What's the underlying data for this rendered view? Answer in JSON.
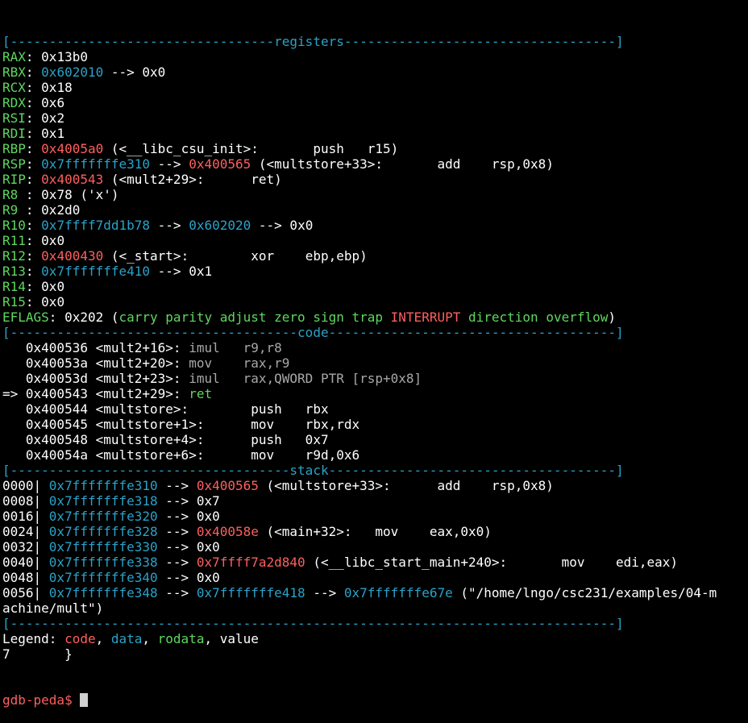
{
  "colors": {
    "background": "#000000",
    "text": "#ffffff",
    "register_name": "#5fd75f",
    "data_address": "#2aa2c8",
    "code_address": "#ff5f5f",
    "dim": "#a8a8a8",
    "cursor": "#d0d0d0"
  },
  "lines": [
    [
      {
        "c": "blue",
        "t": "[----------------------------------registers-----------------------------------]"
      }
    ],
    [
      {
        "c": "green",
        "t": "RAX"
      },
      {
        "c": "white",
        "t": ": 0x13b0"
      }
    ],
    [
      {
        "c": "green",
        "t": "RBX"
      },
      {
        "c": "white",
        "t": ": "
      },
      {
        "c": "blue",
        "t": "0x602010"
      },
      {
        "c": "white",
        "t": " --> 0x0"
      }
    ],
    [
      {
        "c": "green",
        "t": "RCX"
      },
      {
        "c": "white",
        "t": ": 0x18"
      }
    ],
    [
      {
        "c": "green",
        "t": "RDX"
      },
      {
        "c": "white",
        "t": ": 0x6"
      }
    ],
    [
      {
        "c": "green",
        "t": "RSI"
      },
      {
        "c": "white",
        "t": ": 0x2"
      }
    ],
    [
      {
        "c": "green",
        "t": "RDI"
      },
      {
        "c": "white",
        "t": ": 0x1"
      }
    ],
    [
      {
        "c": "green",
        "t": "RBP"
      },
      {
        "c": "white",
        "t": ": "
      },
      {
        "c": "red",
        "t": "0x4005a0"
      },
      {
        "c": "white",
        "t": " (<__libc_csu_init>:       push   r15)"
      }
    ],
    [
      {
        "c": "green",
        "t": "RSP"
      },
      {
        "c": "white",
        "t": ": "
      },
      {
        "c": "blue",
        "t": "0x7fffffffe310"
      },
      {
        "c": "white",
        "t": " --> "
      },
      {
        "c": "red",
        "t": "0x400565"
      },
      {
        "c": "white",
        "t": " (<multstore+33>:       add    rsp,0x8)"
      }
    ],
    [
      {
        "c": "green",
        "t": "RIP"
      },
      {
        "c": "white",
        "t": ": "
      },
      {
        "c": "red",
        "t": "0x400543"
      },
      {
        "c": "white",
        "t": " (<mult2+29>:      ret)"
      }
    ],
    [
      {
        "c": "green",
        "t": "R8 "
      },
      {
        "c": "white",
        "t": ": 0x78 ('x')"
      }
    ],
    [
      {
        "c": "green",
        "t": "R9 "
      },
      {
        "c": "white",
        "t": ": 0x2d0"
      }
    ],
    [
      {
        "c": "green",
        "t": "R10"
      },
      {
        "c": "white",
        "t": ": "
      },
      {
        "c": "blue",
        "t": "0x7ffff7dd1b78"
      },
      {
        "c": "white",
        "t": " --> "
      },
      {
        "c": "blue",
        "t": "0x602020"
      },
      {
        "c": "white",
        "t": " --> 0x0"
      }
    ],
    [
      {
        "c": "green",
        "t": "R11"
      },
      {
        "c": "white",
        "t": ": 0x0"
      }
    ],
    [
      {
        "c": "green",
        "t": "R12"
      },
      {
        "c": "white",
        "t": ": "
      },
      {
        "c": "red",
        "t": "0x400430"
      },
      {
        "c": "white",
        "t": " (<_start>:        xor    ebp,ebp)"
      }
    ],
    [
      {
        "c": "green",
        "t": "R13"
      },
      {
        "c": "white",
        "t": ": "
      },
      {
        "c": "blue",
        "t": "0x7fffffffe410"
      },
      {
        "c": "white",
        "t": " --> 0x1"
      }
    ],
    [
      {
        "c": "green",
        "t": "R14"
      },
      {
        "c": "white",
        "t": ": 0x0"
      }
    ],
    [
      {
        "c": "green",
        "t": "R15"
      },
      {
        "c": "white",
        "t": ": 0x0"
      }
    ],
    [
      {
        "c": "green",
        "t": "EFLAGS"
      },
      {
        "c": "white",
        "t": ": 0x202 ("
      },
      {
        "c": "green",
        "t": "carry parity adjust zero sign trap "
      },
      {
        "c": "red",
        "t": "INTERRUPT"
      },
      {
        "c": "green",
        "t": " direction overflow"
      },
      {
        "c": "white",
        "t": ")"
      }
    ],
    [
      {
        "c": "blue",
        "t": "[-------------------------------------code-------------------------------------]"
      }
    ],
    [
      {
        "c": "white",
        "t": "   0x400536 <mult2+16>: "
      },
      {
        "c": "gray",
        "t": "imul   r9,r8"
      }
    ],
    [
      {
        "c": "white",
        "t": "   0x40053a <mult2+20>: "
      },
      {
        "c": "gray",
        "t": "mov    rax,r9"
      }
    ],
    [
      {
        "c": "white",
        "t": "   0x40053d <mult2+23>: "
      },
      {
        "c": "gray",
        "t": "imul   rax,QWORD PTR [rsp+0x8]"
      }
    ],
    [
      {
        "c": "white",
        "t": "=> 0x400543 <mult2+29>: "
      },
      {
        "c": "green",
        "t": "ret"
      }
    ],
    [
      {
        "c": "white",
        "t": "   0x400544 <multstore>:        push   rbx"
      }
    ],
    [
      {
        "c": "white",
        "t": "   0x400545 <multstore+1>:      mov    rbx,rdx"
      }
    ],
    [
      {
        "c": "white",
        "t": "   0x400548 <multstore+4>:      push   0x7"
      }
    ],
    [
      {
        "c": "white",
        "t": "   0x40054a <multstore+6>:      mov    r9d,0x6"
      }
    ],
    [
      {
        "c": "blue",
        "t": "[------------------------------------stack-------------------------------------]"
      }
    ],
    [
      {
        "c": "white",
        "t": "0000| "
      },
      {
        "c": "blue",
        "t": "0x7fffffffe310"
      },
      {
        "c": "white",
        "t": " --> "
      },
      {
        "c": "red",
        "t": "0x400565"
      },
      {
        "c": "white",
        "t": " (<multstore+33>:      add    rsp,0x8)"
      }
    ],
    [
      {
        "c": "white",
        "t": "0008| "
      },
      {
        "c": "blue",
        "t": "0x7fffffffe318"
      },
      {
        "c": "white",
        "t": " --> 0x7"
      }
    ],
    [
      {
        "c": "white",
        "t": "0016| "
      },
      {
        "c": "blue",
        "t": "0x7fffffffe320"
      },
      {
        "c": "white",
        "t": " --> 0x0"
      }
    ],
    [
      {
        "c": "white",
        "t": "0024| "
      },
      {
        "c": "blue",
        "t": "0x7fffffffe328"
      },
      {
        "c": "white",
        "t": " --> "
      },
      {
        "c": "red",
        "t": "0x40058e"
      },
      {
        "c": "white",
        "t": " (<main+32>:   mov    eax,0x0)"
      }
    ],
    [
      {
        "c": "white",
        "t": "0032| "
      },
      {
        "c": "blue",
        "t": "0x7fffffffe330"
      },
      {
        "c": "white",
        "t": " --> 0x0"
      }
    ],
    [
      {
        "c": "white",
        "t": "0040| "
      },
      {
        "c": "blue",
        "t": "0x7fffffffe338"
      },
      {
        "c": "white",
        "t": " --> "
      },
      {
        "c": "red",
        "t": "0x7ffff7a2d840"
      },
      {
        "c": "white",
        "t": " (<__libc_start_main+240>:       mov    edi,eax)"
      }
    ],
    [
      {
        "c": "white",
        "t": "0048| "
      },
      {
        "c": "blue",
        "t": "0x7fffffffe340"
      },
      {
        "c": "white",
        "t": " --> 0x0"
      }
    ],
    [
      {
        "c": "white",
        "t": "0056| "
      },
      {
        "c": "blue",
        "t": "0x7fffffffe348"
      },
      {
        "c": "white",
        "t": " --> "
      },
      {
        "c": "blue",
        "t": "0x7fffffffe418"
      },
      {
        "c": "white",
        "t": " --> "
      },
      {
        "c": "blue",
        "t": "0x7fffffffe67e"
      },
      {
        "c": "white",
        "t": " (\"/home/lngo/csc231/examples/04-m"
      }
    ],
    [
      {
        "c": "white",
        "t": "achine/mult\")"
      }
    ],
    [
      {
        "c": "blue",
        "t": "[------------------------------------------------------------------------------]"
      }
    ],
    [
      {
        "c": "white",
        "t": "Legend: "
      },
      {
        "c": "red",
        "t": "code"
      },
      {
        "c": "white",
        "t": ", "
      },
      {
        "c": "blue",
        "t": "data"
      },
      {
        "c": "white",
        "t": ", "
      },
      {
        "c": "green",
        "t": "rodata"
      },
      {
        "c": "white",
        "t": ", value"
      }
    ],
    [
      {
        "c": "white",
        "t": "7       }"
      }
    ]
  ],
  "prompt": {
    "label": "gdb-peda$",
    "input": " "
  }
}
